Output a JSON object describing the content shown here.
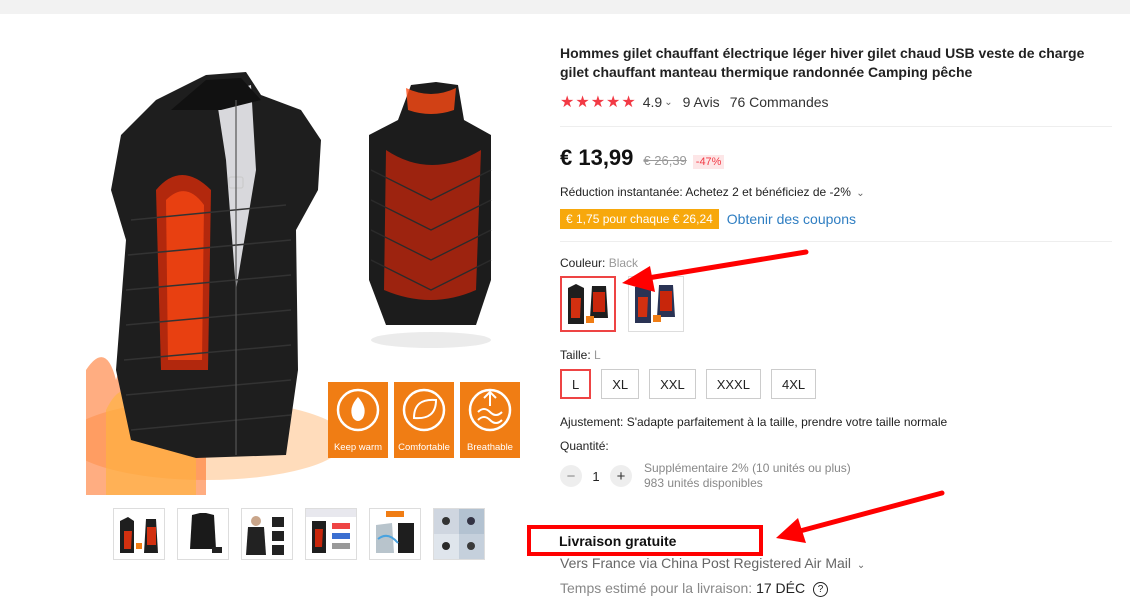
{
  "product": {
    "title": "Hommes gilet chauffant électrique léger hiver gilet chaud USB veste de charge gilet chauffant manteau thermique randonnée Camping pêche",
    "stars": "★★★★★",
    "rating": "4.9",
    "reviews": "9 Avis",
    "orders": "76 Commandes",
    "price": "€ 13,99",
    "old_price": "€ 26,39",
    "discount": "-47%",
    "instant_discount": "Réduction instantanée: Achetez 2 et bénéficiez de -2%",
    "coupon": "€ 1,75 pour chaque € 26,24",
    "get_coupons": "Obtenir des coupons"
  },
  "image_badges": [
    "Keep warm",
    "Comfortable",
    "Breathable"
  ],
  "color": {
    "label": "Couleur:",
    "selected": "Black"
  },
  "size": {
    "label": "Taille:",
    "selected": "L",
    "options": [
      "L",
      "XL",
      "XXL",
      "XXXL",
      "4XL"
    ]
  },
  "fit": "Ajustement: S'adapte parfaitement à la taille, prendre votre taille normale",
  "quantity": {
    "label": "Quantité:",
    "value": "1",
    "minus": "−",
    "plus": "+",
    "note1": "Supplémentaire 2% (10 unités ou plus)",
    "note2": "983 unités disponibles"
  },
  "shipping": {
    "free": "Livraison gratuite",
    "via": "Vers France via China Post Registered Air Mail",
    "estimate_label": "Temps estimé pour la livraison:",
    "estimate_date": "17 DÉC",
    "help_glyph": "?"
  },
  "colors": {
    "accent_red": "#f23a45",
    "annotation_red": "#ff0000",
    "coupon_orange": "#f7a80c",
    "link_blue": "#2f7ec2"
  }
}
